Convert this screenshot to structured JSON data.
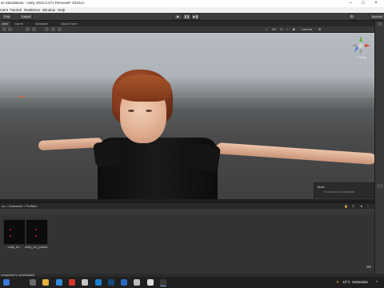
{
  "window": {
    "title": "ss Standalone - Unity 2023.3.471 Personal* <DX11>"
  },
  "menu": [
    "ment",
    "Tutorial",
    "Realtimes",
    "Window",
    "Help"
  ],
  "toolbar": {
    "account_button": "Proj",
    "cloud_button": "Lasud",
    "play_icon": "play-icon",
    "pause_icon": "pause-icon",
    "step_icon": "step-icon",
    "right_label": "Account"
  },
  "tabs": [
    "ene",
    "Game",
    "Animator",
    "Asset Store"
  ],
  "scene_toolbar": {
    "camera_label": "Camera"
  },
  "viewport": {
    "gizmo_label": "< Persp",
    "tools_overlay_title": "Tools",
    "tools_overlay_text": "No custom tool available"
  },
  "project": {
    "breadcrumb": "ss > Character > Prefabs",
    "assets": [
      {
        "name": "unity_bo"
      },
      {
        "name": "unity_bo_posed"
      }
    ]
  },
  "status": {
    "message": "component is not initialized"
  },
  "taskbar": {
    "weather_temp": "10°C",
    "weather_text": "Sebastian"
  },
  "colors": {
    "accent": "#3a79d9",
    "asset_dot": "#d02020"
  }
}
